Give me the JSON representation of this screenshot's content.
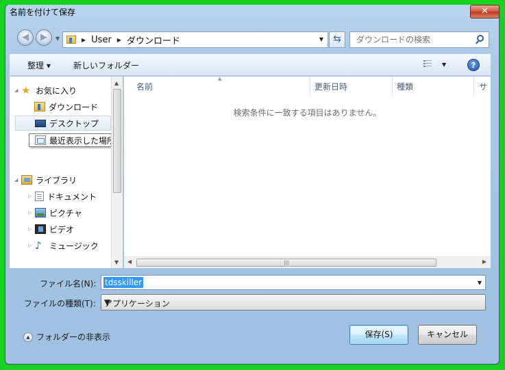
{
  "window": {
    "title": "名前を付けて保存",
    "close_label": "✕"
  },
  "address_bar": {
    "crumbs": [
      "User",
      "ダウンロード"
    ]
  },
  "search": {
    "placeholder": "ダウンロードの検索"
  },
  "toolbar": {
    "organize_label": "整理 ▾",
    "new_folder_label": "新しいフォルダー",
    "help_label": "?"
  },
  "nav_pane": {
    "favorites": {
      "label": "お気に入り",
      "items": [
        "ダウンロード",
        "デスクトップ",
        "最近表示した場所"
      ]
    },
    "libraries": {
      "label": "ライブラリ",
      "items": [
        "ドキュメント",
        "ピクチャ",
        "ビデオ",
        "ミュージック"
      ]
    }
  },
  "file_list": {
    "columns": [
      "名前",
      "更新日時",
      "種類",
      "サ"
    ],
    "empty_message": "検索条件に一致する項目はありません。"
  },
  "form": {
    "filename_label": "ファイル名(N):",
    "filename_value": "tdsskiller",
    "filetype_label": "ファイルの種類(T):",
    "filetype_value": "アプリケーション"
  },
  "footer": {
    "hide_folders_label": "フォルダーの非表示",
    "save_label": "保存(S)",
    "cancel_label": "キャンセル"
  },
  "colors": {
    "outer_frame": "#17d21f",
    "selection": "#3399ff",
    "close_button": "#c9462c"
  }
}
